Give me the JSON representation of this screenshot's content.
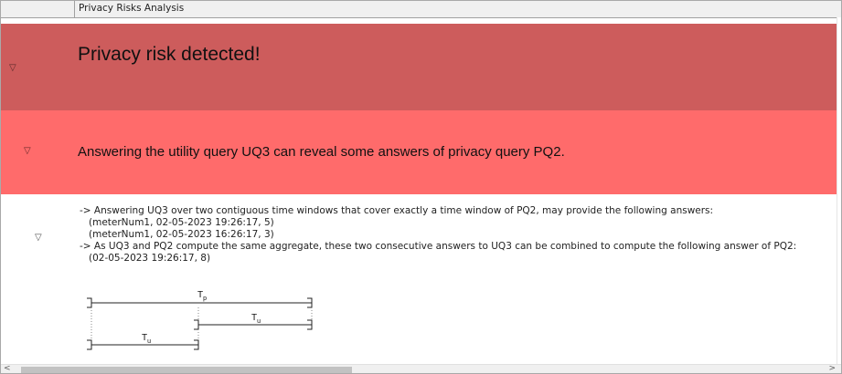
{
  "window": {
    "title": "Privacy Risks Analysis"
  },
  "risk": {
    "heading": "Privacy risk detected!",
    "summary": "Answering the utility query UQ3 can reveal some answers of privacy query PQ2."
  },
  "details": {
    "line1": "-> Answering UQ3 over two contiguous time windows that cover exactly a time window of PQ2, may provide the following answers:",
    "answer1": "(meterNum1, 02-05-2023 19:26:17, 5)",
    "answer2": "(meterNum1, 02-05-2023 16:26:17, 3)",
    "line2": "-> As UQ3 and PQ2 compute the same aggregate, these two consecutive answers to UQ3 can be combined to compute the following answer of PQ2:",
    "combined": "(02-05-2023 19:26:17, 8)"
  },
  "diagram": {
    "tp_label": "T",
    "tp_sub": "p",
    "tu_label": "T",
    "tu_sub": "u"
  },
  "icons": {
    "expand": "triangle-down-icon",
    "scroll_left": "chevron-left-icon",
    "scroll_right": "chevron-right-icon"
  },
  "colors": {
    "band_dark": "#cd5c5c",
    "band_light": "#ff6b6b"
  }
}
